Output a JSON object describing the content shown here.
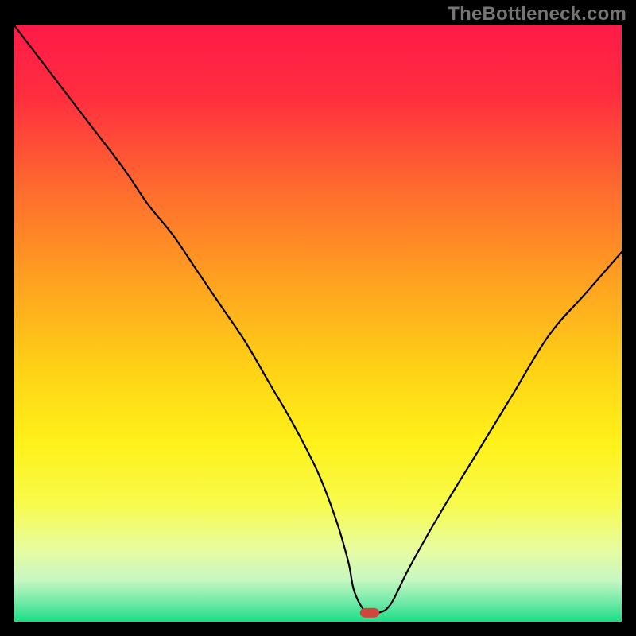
{
  "watermark": "TheBottleneck.com",
  "chart_data": {
    "type": "line",
    "title": "",
    "xlabel": "",
    "ylabel": "",
    "xlim": [
      0,
      100
    ],
    "ylim": [
      0,
      100
    ],
    "background_gradient": {
      "stops": [
        {
          "offset": 0.0,
          "color": "#ff1a47"
        },
        {
          "offset": 0.12,
          "color": "#ff2e3f"
        },
        {
          "offset": 0.28,
          "color": "#ff6d2e"
        },
        {
          "offset": 0.44,
          "color": "#ffa51f"
        },
        {
          "offset": 0.58,
          "color": "#ffd316"
        },
        {
          "offset": 0.7,
          "color": "#fff11a"
        },
        {
          "offset": 0.8,
          "color": "#f8fb4a"
        },
        {
          "offset": 0.88,
          "color": "#e8fca1"
        },
        {
          "offset": 0.93,
          "color": "#c6f7c1"
        },
        {
          "offset": 0.97,
          "color": "#6be9a6"
        },
        {
          "offset": 1.0,
          "color": "#18de84"
        }
      ]
    },
    "curve": {
      "x": [
        0,
        6,
        12,
        18,
        22,
        26,
        30,
        34,
        38,
        42,
        46,
        50,
        53,
        55,
        56,
        58,
        60,
        62,
        65,
        70,
        76,
        82,
        88,
        94,
        100
      ],
      "y": [
        100,
        92,
        84,
        76,
        70,
        65,
        59,
        53,
        47,
        40,
        33,
        25,
        17,
        10,
        5,
        1.5,
        1.5,
        3,
        9,
        18,
        28,
        38,
        48,
        55,
        62
      ]
    },
    "marker": {
      "x": 58.5,
      "y": 1.5,
      "color": "#d0463d",
      "width": 3.2,
      "height": 1.6,
      "rx": 0.9
    }
  }
}
